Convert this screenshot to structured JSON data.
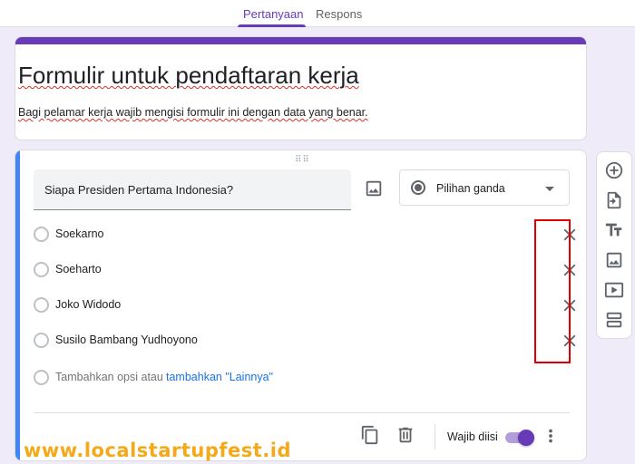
{
  "tabs": [
    {
      "label": "Pertanyaan",
      "active": true
    },
    {
      "label": "Respons",
      "active": false
    }
  ],
  "form": {
    "title": "Formulir untuk pendaftaran kerja",
    "description": "Bagi pelamar kerja wajib mengisi formulir ini dengan data yang benar."
  },
  "question": {
    "text": "Siapa Presiden Pertama Indonesia?",
    "type": "Pilihan ganda",
    "options": [
      {
        "label": "Soekarno"
      },
      {
        "label": "Soeharto"
      },
      {
        "label": "Joko Widodo"
      },
      {
        "label": "Susilo Bambang Yudhoyono"
      }
    ],
    "add_option_label": "Tambahkan opsi atau",
    "add_other_label": "tambahkan \"Lainnya\"",
    "required_label": "Wajib diisi",
    "required": true
  },
  "toolbar_icons": [
    "add-circle-icon",
    "import-icon",
    "title-icon",
    "image-icon",
    "video-icon",
    "section-icon"
  ],
  "watermark": "www.localstartupfest.id",
  "colors": {
    "accent": "#673ab7",
    "active_bar": "#4285f4",
    "link": "#1a73e8",
    "highlight_box": "#e00000",
    "watermark": "#f5a000"
  }
}
